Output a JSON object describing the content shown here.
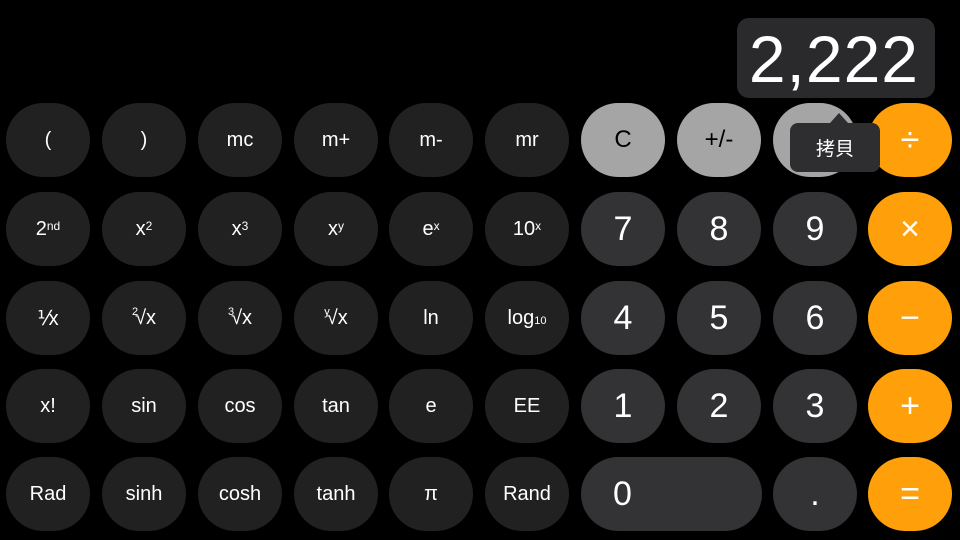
{
  "display": {
    "value": "2,222"
  },
  "tooltip": {
    "label": "拷貝"
  },
  "colors": {
    "operator": "#ff9f0a",
    "function": "#a5a5a5",
    "number": "#333335",
    "scientific": "#212121"
  },
  "keys": [
    {
      "name": "open-paren",
      "label": "(",
      "type": "sci"
    },
    {
      "name": "close-paren",
      "label": ")",
      "type": "sci"
    },
    {
      "name": "mc",
      "label": "mc",
      "type": "sci"
    },
    {
      "name": "m-plus",
      "label": "m+",
      "type": "sci"
    },
    {
      "name": "m-minus",
      "label": "m-",
      "type": "sci"
    },
    {
      "name": "mr",
      "label": "mr",
      "type": "sci"
    },
    {
      "name": "clear",
      "label": "C",
      "type": "fn"
    },
    {
      "name": "plus-minus",
      "label": "+/-",
      "type": "fn"
    },
    {
      "name": "percent",
      "label": "",
      "type": "fn"
    },
    {
      "name": "divide",
      "label": "÷",
      "type": "op"
    },
    {
      "name": "second",
      "label": "2",
      "sup": "nd",
      "type": "sci"
    },
    {
      "name": "x-squared",
      "label": "x",
      "sup": "2",
      "type": "sci"
    },
    {
      "name": "x-cubed",
      "label": "x",
      "sup": "3",
      "type": "sci"
    },
    {
      "name": "x-to-y",
      "label": "x",
      "sup": "y",
      "type": "sci"
    },
    {
      "name": "e-to-x",
      "label": "e",
      "sup": "x",
      "type": "sci"
    },
    {
      "name": "ten-to-x",
      "label": "10",
      "sup": "x",
      "type": "sci"
    },
    {
      "name": "seven",
      "label": "7",
      "type": "num"
    },
    {
      "name": "eight",
      "label": "8",
      "type": "num"
    },
    {
      "name": "nine",
      "label": "9",
      "type": "num"
    },
    {
      "name": "multiply",
      "label": "×",
      "type": "op"
    },
    {
      "name": "reciprocal",
      "label": "⅟x",
      "type": "sci"
    },
    {
      "name": "square-root",
      "pre": "2",
      "label": "√x",
      "type": "sci"
    },
    {
      "name": "cube-root",
      "pre": "3",
      "label": "√x",
      "type": "sci"
    },
    {
      "name": "y-root",
      "pre": "y",
      "label": "√x",
      "type": "sci"
    },
    {
      "name": "ln",
      "label": "ln",
      "type": "sci"
    },
    {
      "name": "log10",
      "label": "log",
      "sub": "10",
      "type": "sci"
    },
    {
      "name": "four",
      "label": "4",
      "type": "num"
    },
    {
      "name": "five",
      "label": "5",
      "type": "num"
    },
    {
      "name": "six",
      "label": "6",
      "type": "num"
    },
    {
      "name": "subtract",
      "label": "−",
      "type": "op"
    },
    {
      "name": "factorial",
      "label": "x!",
      "type": "sci"
    },
    {
      "name": "sin",
      "label": "sin",
      "type": "sci"
    },
    {
      "name": "cos",
      "label": "cos",
      "type": "sci"
    },
    {
      "name": "tan",
      "label": "tan",
      "type": "sci"
    },
    {
      "name": "e",
      "label": "e",
      "type": "sci"
    },
    {
      "name": "ee",
      "label": "EE",
      "type": "sci"
    },
    {
      "name": "one",
      "label": "1",
      "type": "num"
    },
    {
      "name": "two",
      "label": "2",
      "type": "num"
    },
    {
      "name": "three",
      "label": "3",
      "type": "num"
    },
    {
      "name": "add",
      "label": "+",
      "type": "op"
    },
    {
      "name": "rad",
      "label": "Rad",
      "type": "sci"
    },
    {
      "name": "sinh",
      "label": "sinh",
      "type": "sci"
    },
    {
      "name": "cosh",
      "label": "cosh",
      "type": "sci"
    },
    {
      "name": "tanh",
      "label": "tanh",
      "type": "sci"
    },
    {
      "name": "pi",
      "label": "π",
      "type": "sci"
    },
    {
      "name": "rand",
      "label": "Rand",
      "type": "sci"
    },
    {
      "name": "zero",
      "label": "0",
      "type": "num",
      "wide": true
    },
    {
      "name": "decimal",
      "label": ".",
      "type": "num"
    },
    {
      "name": "equals",
      "label": "=",
      "type": "op"
    }
  ]
}
